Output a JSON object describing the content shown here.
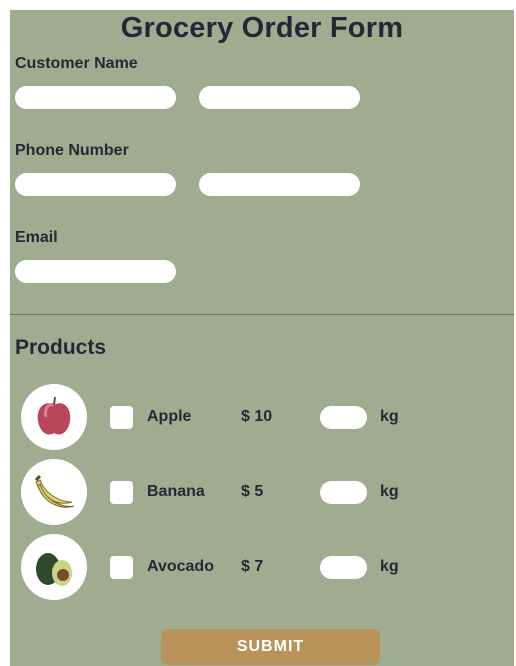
{
  "form": {
    "title": "Grocery Order Form",
    "customer_name_label": "Customer Name",
    "phone_label": "Phone Number",
    "email_label": "Email"
  },
  "products": {
    "title": "Products",
    "items": [
      {
        "name": "Apple",
        "price": "$ 10",
        "unit": "kg",
        "icon": "apple-icon"
      },
      {
        "name": "Banana",
        "price": "$ 5",
        "unit": "kg",
        "icon": "banana-icon"
      },
      {
        "name": "Avocado",
        "price": "$ 7",
        "unit": "kg",
        "icon": "avocado-icon"
      }
    ]
  },
  "submit_label": "SUBMIT",
  "colors": {
    "panel_bg": "#a0ac90",
    "text": "#1f2a37",
    "button": "#b8935a"
  }
}
